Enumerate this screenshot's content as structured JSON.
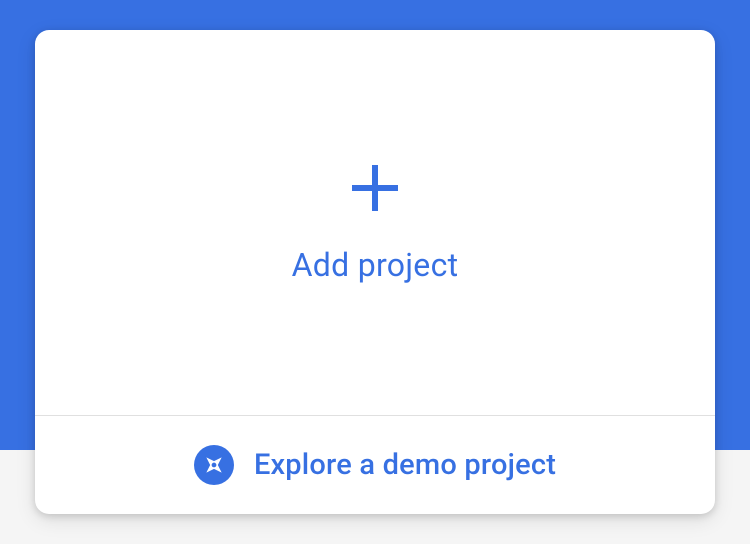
{
  "colors": {
    "primary": "#3770E2",
    "cardBg": "#ffffff",
    "pageBg": "#f5f5f5",
    "divider": "#e0e0e0"
  },
  "addProject": {
    "label": "Add project",
    "iconName": "plus-icon"
  },
  "exploreDemo": {
    "label": "Explore a demo project",
    "iconName": "compass-icon"
  }
}
